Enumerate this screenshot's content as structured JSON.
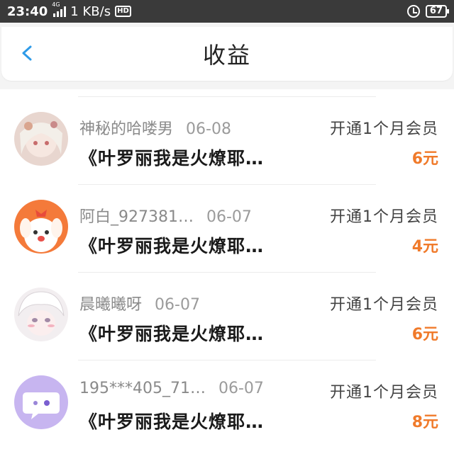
{
  "status_bar": {
    "time": "23:40",
    "network": "4G",
    "speed": "1 KB/s",
    "hd": "HD",
    "battery": "67"
  },
  "header": {
    "title": "收益",
    "back_icon": "chevron-left-icon",
    "accent": "#2f9be8"
  },
  "colors": {
    "amount": "#f07a2a"
  },
  "records": [
    {
      "user": "神秘的哈喽男",
      "date": "06-08",
      "book": "《叶罗丽我是火燎耶…",
      "type": "开通1个月会员",
      "amount": "6元",
      "avatar": "anime-girl-avatar"
    },
    {
      "user": "阿白_927381…",
      "date": "06-07",
      "book": "《叶罗丽我是火燎耶…",
      "type": "开通1个月会员",
      "amount": "4元",
      "avatar": "cartoon-dog-avatar"
    },
    {
      "user": "晨曦曦呀",
      "date": "06-07",
      "book": "《叶罗丽我是火燎耶…",
      "type": "开通1个月会员",
      "amount": "6元",
      "avatar": "anime-boy-avatar"
    },
    {
      "user": "195***405_71…",
      "date": "06-07",
      "book": "《叶罗丽我是火燎耶…",
      "type": "开通1个月会员",
      "amount": "8元",
      "avatar": "chat-bubble-avatar"
    }
  ]
}
